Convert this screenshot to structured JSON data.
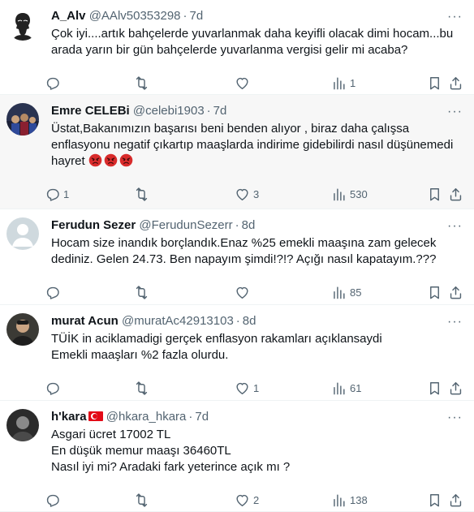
{
  "tweets": [
    {
      "name": "A_Alv",
      "handle": "@AAlv50353298",
      "time": "7d",
      "lines": [
        "Çok iyi....artık bahçelerde yuvarlanmak daha keyifli olacak dimi hocam...bu",
        "arada yarın bir gün bahçelerde yuvarlanma vergisi gelir mi acaba?"
      ],
      "replies": "",
      "retweets": "",
      "likes": "",
      "views": "1"
    },
    {
      "name": "Emre CELEBi",
      "handle": "@celebi1903",
      "time": "7d",
      "lines": [
        "Üstat,Bakanımızın başarısı beni benden alıyor , biraz daha çalışsa",
        "enflasyonu negatif çıkartıp maaşlarda indirime gidebilirdi nasıl düşünemedi",
        "hayret"
      ],
      "emoji": [
        "angry-face-emoji",
        "angry-face-emoji",
        "angry-face-emoji"
      ],
      "replies": "1",
      "retweets": "",
      "likes": "3",
      "views": "530"
    },
    {
      "name": "Ferudun Sezer",
      "handle": "@FerudunSezerr",
      "time": "8d",
      "lines": [
        "Hocam size inandık borçlandık.Enaz  %25 emekli maaşına zam gelecek",
        "dediniz. Gelen 24.73. Ben napayım şimdi!?!? Açığı nasıl kapatayım.???"
      ],
      "replies": "",
      "retweets": "",
      "likes": "",
      "views": "85"
    },
    {
      "name": "murat Acun",
      "handle": "@muratAc42913103",
      "time": "8d",
      "lines": [
        "TÜİK in aciklamadigi gerçek enflasyon rakamları açıklansaydi",
        "Emekli maaşları %2 fazla olurdu."
      ],
      "replies": "",
      "retweets": "",
      "likes": "1",
      "views": "61"
    },
    {
      "name": "h'kara",
      "handle": "@hkara_hkara",
      "time": "7d",
      "lines": [
        "Asgari ücret 17002 TL",
        "En düşük memur maaşı 36460TL",
        "Nasıl iyi mi? Aradaki fark yeterince açık mı ?"
      ],
      "replies": "",
      "retweets": "",
      "likes": "2",
      "views": "138"
    }
  ],
  "icons": {
    "reply": "reply-icon",
    "retweet": "retweet-icon",
    "like": "like-icon",
    "views": "views-icon",
    "bookmark": "bookmark-icon",
    "share": "share-icon",
    "more": "more-icon",
    "flag": "turkey-flag-icon"
  },
  "colors": {
    "muted": "#536471",
    "text": "#0f1419",
    "highlight_bg": "#f7f7f7",
    "divider": "#eff3f4"
  }
}
